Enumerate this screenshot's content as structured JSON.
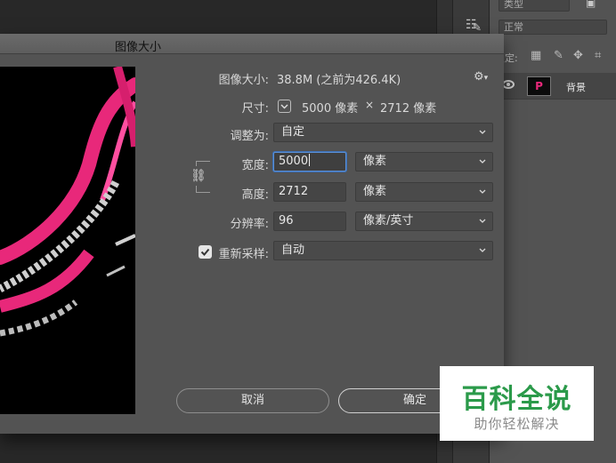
{
  "workspace": {
    "layers": {
      "blend_mode": "正常",
      "kind_label": "类型",
      "lock_label": "锁定:",
      "layer_name": "背景",
      "layer_thumb_letter": "P"
    }
  },
  "dialog": {
    "title": "图像大小",
    "image_size": {
      "label": "图像大小:",
      "value": "38.8M (之前为426.4K)"
    },
    "dimensions": {
      "label": "尺寸:",
      "width_value": "5000 像素",
      "separator": "×",
      "height_value": "2712 像素"
    },
    "fit_to": {
      "label": "调整为:",
      "value": "自定"
    },
    "width": {
      "label": "宽度:",
      "value": "5000",
      "unit": "像素"
    },
    "height": {
      "label": "高度:",
      "value": "2712",
      "unit": "像素"
    },
    "resolution": {
      "label": "分辨率:",
      "value": "96",
      "unit": "像素/英寸"
    },
    "resample": {
      "label": "重新采样:",
      "value": "自动",
      "checked": true
    },
    "buttons": {
      "cancel": "取消",
      "ok": "确定"
    }
  },
  "watermark": {
    "title": "百科全说",
    "subtitle": "助你轻松解决"
  },
  "colors": {
    "dialog_bg": "#535353",
    "field_bg": "#454545",
    "focus_ring": "#5b90d6",
    "watermark_green": "#2b9a4a",
    "jellyfish_pink": "#e8287a"
  }
}
